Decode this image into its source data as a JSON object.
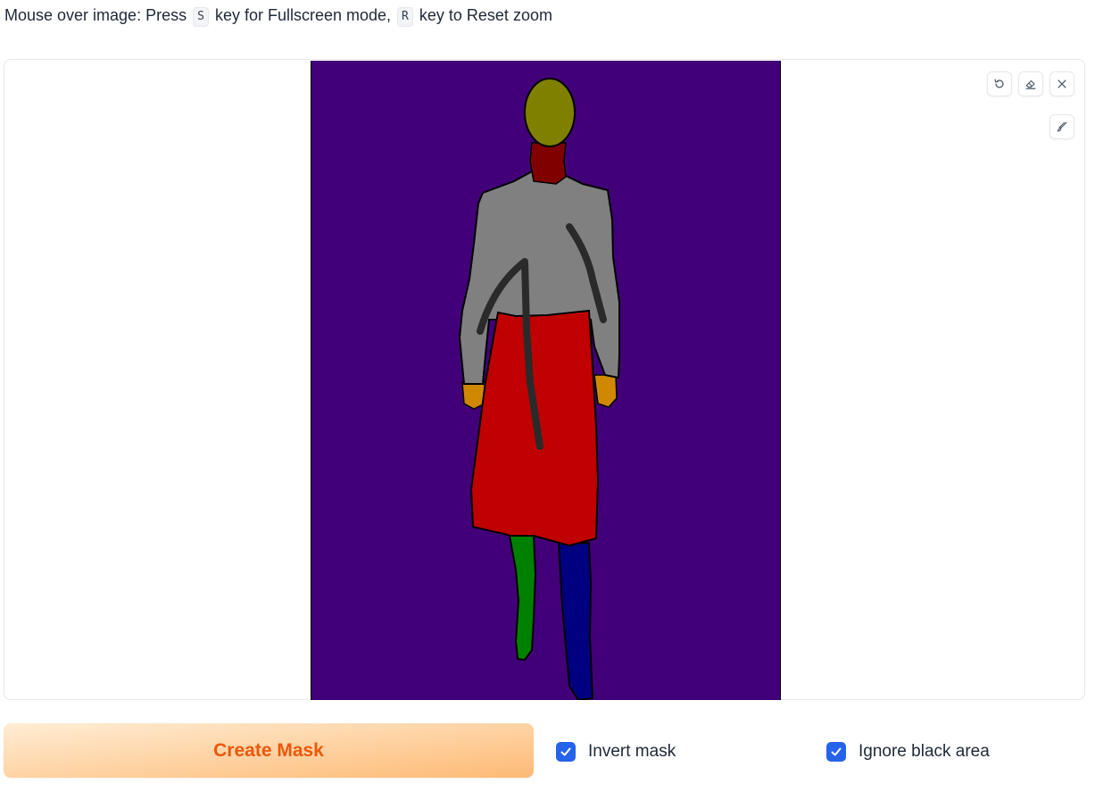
{
  "hint": {
    "prefix": "Mouse over image: Press",
    "key_s": "S",
    "middle": "key for Fullscreen mode,",
    "key_r": "R",
    "suffix": "key to Reset zoom"
  },
  "toolbar": {
    "undo_icon": "undo-icon",
    "eraser_icon": "eraser-icon",
    "close_icon": "close-icon",
    "brush_icon": "brush-icon"
  },
  "canvas": {
    "background_color": "#420078",
    "segments": {
      "head": "#808000",
      "neck": "#800000",
      "upper_clothes": "#808080",
      "skirt": "#c00000",
      "left_leg": "#008000",
      "right_leg": "#000080",
      "hands": "#d08800",
      "strokes": "#2a2a2a"
    }
  },
  "actions": {
    "create_mask_label": "Create Mask",
    "invert_mask_label": "Invert mask",
    "invert_mask_checked": true,
    "ignore_black_label": "Ignore black area",
    "ignore_black_checked": true
  },
  "colors": {
    "accent_orange": "#ea580c",
    "checkbox_blue": "#2563eb"
  }
}
